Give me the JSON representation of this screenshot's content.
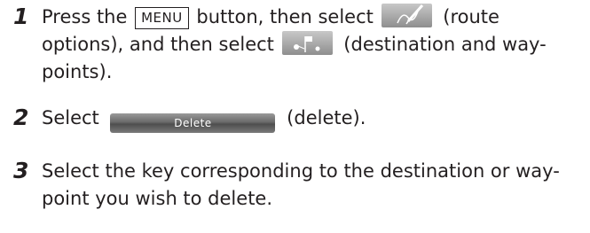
{
  "steps": [
    {
      "number": "1",
      "lines": [
        {
          "t1": "Press the",
          "key": "MENU",
          "t2": "button, then select",
          "t3": "(route"
        },
        {
          "t1": "options), and then select",
          "t2": "(destination and way-"
        },
        {
          "t1": "points)."
        }
      ],
      "icons": [
        "route-options-icon",
        "destination-waypoints-icon"
      ]
    },
    {
      "number": "2",
      "lines": [
        {
          "t1": "Select",
          "key": "Delete",
          "t2": "(delete)."
        }
      ]
    },
    {
      "number": "3",
      "lines": [
        {
          "t1": "Select the key corresponding to the destination or way-"
        },
        {
          "t1": "point you wish to delete."
        }
      ]
    }
  ]
}
